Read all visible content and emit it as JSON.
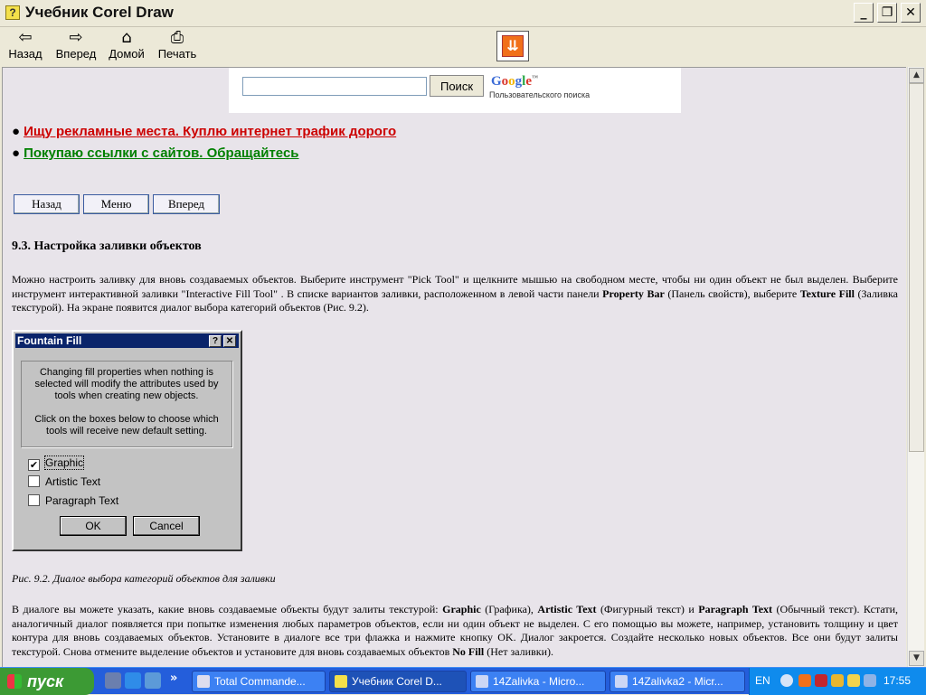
{
  "window": {
    "title": "Учебник Corel Draw",
    "title_icon": "?",
    "controls": {
      "minimize": "_",
      "maximize": "❐",
      "close": "✕"
    }
  },
  "toolbar": {
    "back_label": "Назад",
    "forward_label": "Вперед",
    "home_label": "Домой",
    "print_label": "Печать"
  },
  "google": {
    "search_value": "",
    "button_label": "Поиск",
    "logo_text": "Google",
    "logo_tm": "™",
    "subtitle": "Пользовательского поиска"
  },
  "ads": [
    {
      "text": "Ищу рекламные места. Куплю интернет трафик дорого",
      "color": "#cc0000"
    },
    {
      "text": "Покупаю ссылки с сайтов. Обращайтесь",
      "color": "#008000"
    }
  ],
  "nav_buttons": {
    "back": "Назад",
    "menu": "Меню",
    "forward": "Вперед"
  },
  "heading": "9.3. Настройка заливки объектов",
  "para1": {
    "t1": "Можно настроить заливку для вновь создаваемых объектов. Выберите инструмент \"Pick Tool\" и щелкните мышью на свободном месте, чтобы ни один объект не был выделен. Выберите инструмент интерактивной заливки \"Interactive Fill Tool\" . В списке вариантов заливки, расположенном в левой части панели ",
    "b1": "Property Bar",
    "t2": " (Панель свойств), выберите ",
    "b2": "Texture Fill",
    "t3": " (Заливка текстурой). На экране появится диалог выбора категорий объектов (Рис. 9.2)."
  },
  "dialog": {
    "title": "Fountain Fill",
    "help_btn": "?",
    "close_btn": "✕",
    "message1": "Changing fill properties when nothing is selected will modify the attributes used by tools when creating new objects.",
    "message2": "Click on the boxes below to choose which tools will receive new default setting.",
    "options": [
      {
        "label": "Graphic",
        "checked": "✔"
      },
      {
        "label": "Artistic Text",
        "checked": ""
      },
      {
        "label": "Paragraph Text",
        "checked": ""
      }
    ],
    "ok": "OK",
    "cancel": "Cancel"
  },
  "caption": "Рис. 9.2. Диалог выбора категорий объектов для заливки",
  "para2": {
    "t1": "В диалоге вы можете указать, какие вновь создаваемые объекты будут залиты текстурой: ",
    "b1": "Graphic",
    "t2": " (Графика), ",
    "b2": "Artistic Text",
    "t3": " (Фигурный текст) и ",
    "b3": "Paragraph Text",
    "t4": " (Обычный текст). Кстати, аналогичный диалог появляется при попытке изменения любых параметров объектов, если ни один объект не выделен. С его помощью вы можете, например, установить толщину и цвет контура для вновь создаваемых объектов. Установите в диалоге все три флажка и нажмите кнопку OK. Диалог закроется. Создайте несколько новых объектов. Все они будут залиты текстурой. Снова отмените выделение объектов и установите для вновь создаваемых объектов ",
    "b4": "No Fill",
    "t5": " (Нет заливки)."
  },
  "taskbar": {
    "start": "пуск",
    "quicklaunch_more": "»",
    "tasks": [
      {
        "label": "Total Commande...",
        "active": false
      },
      {
        "label": "Учебник Corel D...",
        "active": true
      },
      {
        "label": "14Zalivka - Micro...",
        "active": false
      },
      {
        "label": "14Zalivka2 - Micr...",
        "active": false
      }
    ],
    "lang": "EN",
    "clock": "17:55"
  }
}
